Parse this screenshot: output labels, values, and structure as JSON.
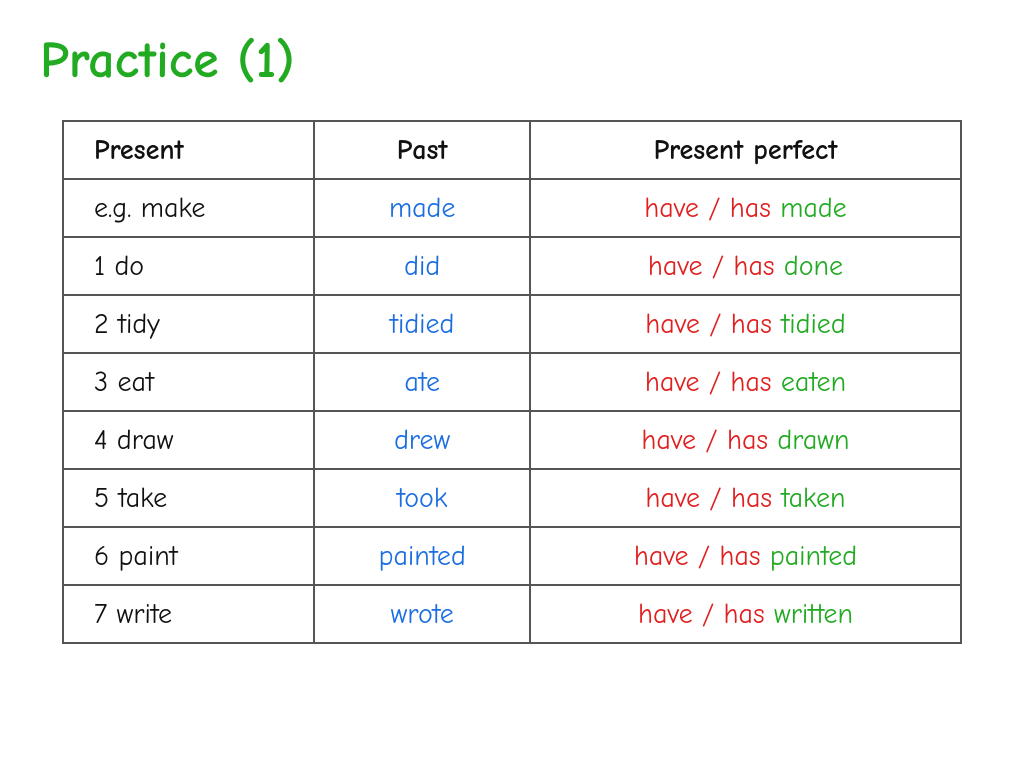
{
  "title": "Practice (1)",
  "table": {
    "headers": {
      "present": "Present",
      "past": "Past",
      "perfect": "Present perfect"
    },
    "rows": [
      {
        "id": "example",
        "present": "e.g. make",
        "past": "made",
        "have_has": "have / has",
        "pp": "made"
      },
      {
        "id": "row1",
        "present": "1  do",
        "past": "did",
        "have_has": "have / has",
        "pp": "done"
      },
      {
        "id": "row2",
        "present": "2  tidy",
        "past": "tidied",
        "have_has": "have / has",
        "pp": "tidied"
      },
      {
        "id": "row3",
        "present": "3  eat",
        "past": "ate",
        "have_has": "have / has",
        "pp": "eaten"
      },
      {
        "id": "row4",
        "present": "4  draw",
        "past": "drew",
        "have_has": "have / has",
        "pp": "drawn"
      },
      {
        "id": "row5",
        "present": "5  take",
        "past": "took",
        "have_has": "have / has",
        "pp": "taken"
      },
      {
        "id": "row6",
        "present": "6  paint",
        "past": "painted",
        "have_has": "have / has",
        "pp": "painted"
      },
      {
        "id": "row7",
        "present": "7  write",
        "past": "wrote",
        "have_has": "have / has",
        "pp": "written"
      }
    ]
  }
}
